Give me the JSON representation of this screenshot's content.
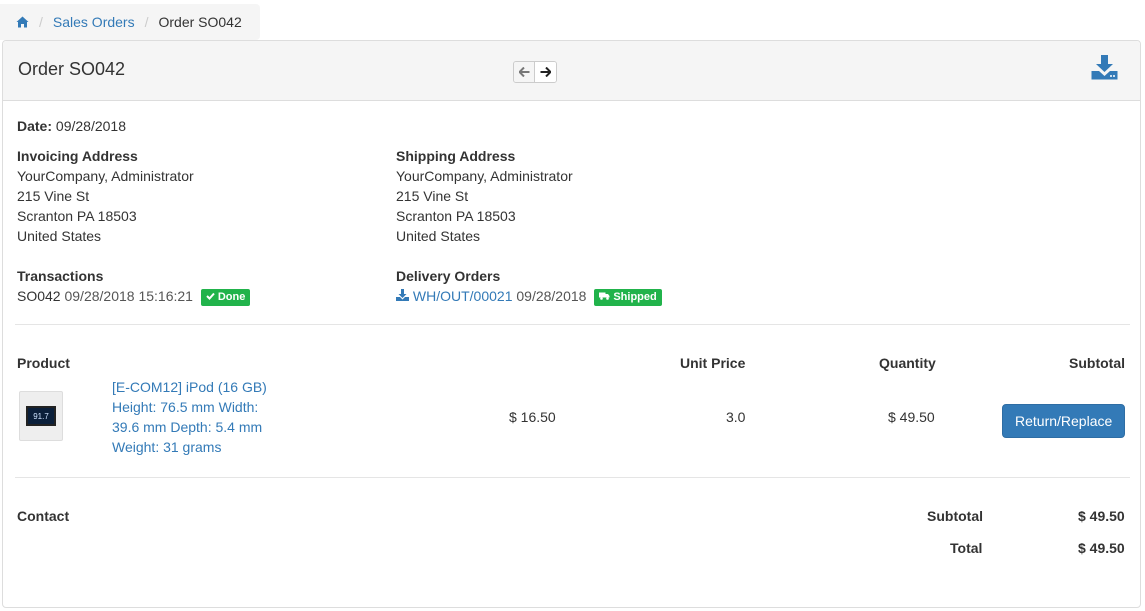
{
  "breadcrumb": {
    "home_icon": "home-icon",
    "items": [
      "Sales Orders",
      "Order SO042"
    ]
  },
  "header": {
    "title": "Order SO042",
    "prev_icon": "arrow-left-icon",
    "next_icon": "arrow-right-icon",
    "download_icon": "download-icon"
  },
  "order": {
    "date_label": "Date:",
    "date_value": "09/28/2018",
    "invoicing": {
      "label": "Invoicing Address",
      "lines": [
        "YourCompany, Administrator",
        "215 Vine St",
        "Scranton PA 18503",
        "United States"
      ]
    },
    "shipping": {
      "label": "Shipping Address",
      "lines": [
        "YourCompany, Administrator",
        "215 Vine St",
        "Scranton PA 18503",
        "United States"
      ]
    },
    "transactions": {
      "label": "Transactions",
      "ref": "SO042",
      "datetime": "09/28/2018 15:16:21",
      "status": "Done"
    },
    "delivery": {
      "label": "Delivery Orders",
      "ref": "WH/OUT/00021",
      "date": "09/28/2018",
      "status": "Shipped"
    }
  },
  "lines_table": {
    "headers": [
      "Product",
      "Unit Price",
      "Quantity",
      "Subtotal"
    ],
    "rows": [
      {
        "product_lines": [
          "[E-COM12] iPod (16 GB)",
          "Height: 76.5 mm Width:",
          "39.6 mm Depth: 5.4 mm",
          "Weight: 31 grams"
        ],
        "image_text": "91.7",
        "unit_price": "$ 16.50",
        "quantity": "3.0",
        "subtotal": "$ 49.50",
        "action": "Return/Replace"
      }
    ]
  },
  "totals": {
    "contact_label": "Contact",
    "subtotal_label": "Subtotal",
    "subtotal_value": "$ 49.50",
    "total_label": "Total",
    "total_value": "$ 49.50"
  },
  "colors": {
    "link": "#337ab7",
    "badge_green": "#21b34b",
    "button_primary": "#337ab7"
  }
}
